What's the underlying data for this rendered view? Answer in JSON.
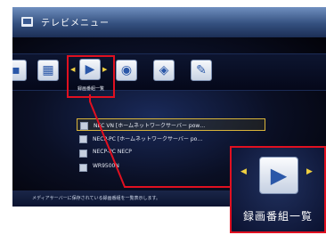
{
  "window": {
    "title": "テレビメニュー"
  },
  "menu": {
    "selected_label": "録画番組一覧",
    "icons": [
      "grid-icon",
      "recorded-list-icon",
      "record-schedule-icon",
      "eye-icon",
      "wrench-icon"
    ]
  },
  "list": {
    "items": [
      {
        "text": "NEC VN [ホームネットワークサーバー pow…"
      },
      {
        "text": "NECP-PC [ホームネットワークサーバー po…"
      },
      {
        "text": "NECP-PC NECP"
      },
      {
        "text": "WR9500N"
      }
    ]
  },
  "status": {
    "text": "メディアサーバーに保存されている録画番組を一覧表示します。"
  },
  "zoom": {
    "label": "録画番組一覧"
  },
  "colors": {
    "highlight": "#e01020",
    "titlebar": "#34507f",
    "arrow": "#f0d040"
  }
}
